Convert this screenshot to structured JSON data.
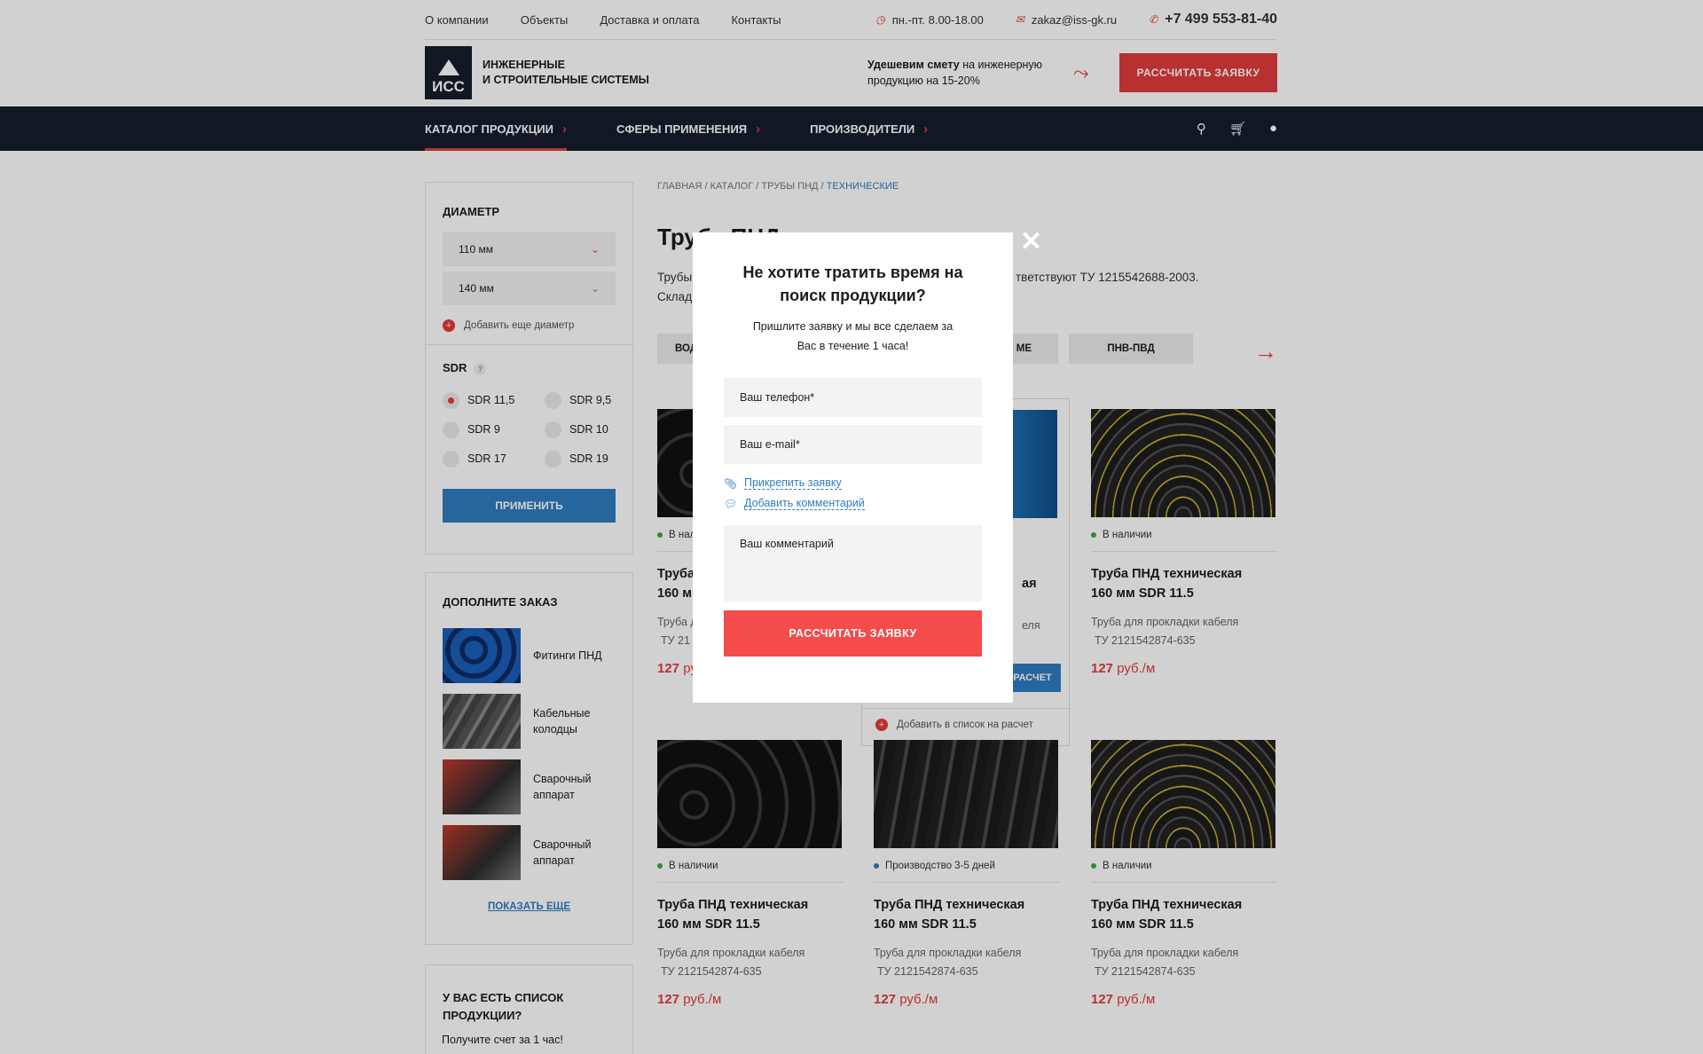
{
  "topbar": {
    "nav": [
      "О компании",
      "Объекты",
      "Доставка и оплата",
      "Контакты"
    ],
    "hours": "пн.-пт. 8.00-18.00",
    "email": "zakaz@iss-gk.ru",
    "phone": "+7 499 553-81-40"
  },
  "header": {
    "logo_text": "ИСС",
    "brand_line1": "Инженерные",
    "brand_line2": "и строительные системы",
    "promo_bold": "Удешевим смету",
    "promo_rest": " на инженерную продукцию на 15-20%",
    "cta": "Рассчитать заявку"
  },
  "navbar": {
    "items": [
      "Каталог продукции",
      "Сферы применения",
      "Производители"
    ],
    "icons": [
      "search-icon",
      "cart-icon",
      "user-icon"
    ]
  },
  "sidebar": {
    "diameter_title": "Диаметр",
    "diameters": [
      "110 мм",
      "140 мм"
    ],
    "add_diameter": "Добавить еще диаметр",
    "sdr_title": "SDR",
    "sdr_options": [
      "SDR 11,5",
      "SDR 9,5",
      "SDR 9",
      "SDR 10",
      "SDR 17",
      "SDR 19"
    ],
    "apply": "Применить",
    "addons_title": "Дополните заказ",
    "addons": [
      "Фитинги ПНД",
      "Кабельные колодцы",
      "Сварочный аппарат",
      "Сварочный аппарат"
    ],
    "show_more": "Показать еще",
    "list_title": "У вас есть список продукции?",
    "list_sub": "Получите счет за 1 час!"
  },
  "content": {
    "breadcrumbs": [
      "Главная",
      "Каталог",
      "Трубы ПНД",
      "Технические"
    ],
    "title": "Труба ПНД",
    "lead_a": "Трубы",
    "lead_b": "тветствуют ТУ 1215542688-2003.",
    "lead_c": "Склад",
    "tags": [
      "вод",
      "ме",
      "ПНВ-ПВД"
    ],
    "add_to_list": "Добавить в список на расчет",
    "calc_btn": "расчет"
  },
  "products": [
    {
      "stock": "В наличии",
      "stock_color": "#3aa845",
      "name": "Труба",
      "name2": "160 м",
      "desc": "Труба д",
      "desc2": "ТУ 21",
      "price": "127"
    },
    {
      "stock": "",
      "stock_color": "#3aa845",
      "name": "ая",
      "name2": "",
      "desc": "еля",
      "desc2": "",
      "price": ""
    },
    {
      "stock": "В наличии",
      "stock_color": "#3aa845",
      "name": "Труба ПНД техническая",
      "name2": "160 мм SDR 11.5",
      "desc": "Труба для прокладки кабеля",
      "desc2": "ТУ 2121542874-635",
      "price": "127"
    },
    {
      "stock": "В наличии",
      "stock_color": "#3aa845",
      "name": "Труба ПНД техническая",
      "name2": "160 мм SDR 11.5",
      "desc": "Труба для прокладки кабеля",
      "desc2": "ТУ 2121542874-635",
      "price": "127"
    },
    {
      "stock": "Производство 3-5 дней",
      "stock_color": "#2f7cc0",
      "name": "Труба ПНД техническая",
      "name2": "160 мм SDR 11.5",
      "desc": "Труба для прокладки кабеля",
      "desc2": "ТУ 2121542874-635",
      "price": "127"
    },
    {
      "stock": "В наличии",
      "stock_color": "#3aa845",
      "name": "Труба ПНД техническая",
      "name2": "160 мм SDR 11.5",
      "desc": "Труба для прокладки кабеля",
      "desc2": "ТУ 2121542874-635",
      "price": "127"
    }
  ],
  "price_unit": " руб./м",
  "modal": {
    "title": "Не хотите тратить время на поиск продукции?",
    "subtitle": "Пришлите заявку и мы все сделаем за Вас в течение 1 часа!",
    "phone_placeholder": "Ваш телефон*",
    "email_placeholder": "Ваш e-mail*",
    "attach": "Прикрепить заявку",
    "comment_link": "Добавить комментарий",
    "comment_placeholder": "Ваш комментарий",
    "submit": "Рассчитать заявку"
  },
  "colors": {
    "accent": "#e23b3b",
    "navy": "#151e2c",
    "blue": "#2f7cc0"
  }
}
